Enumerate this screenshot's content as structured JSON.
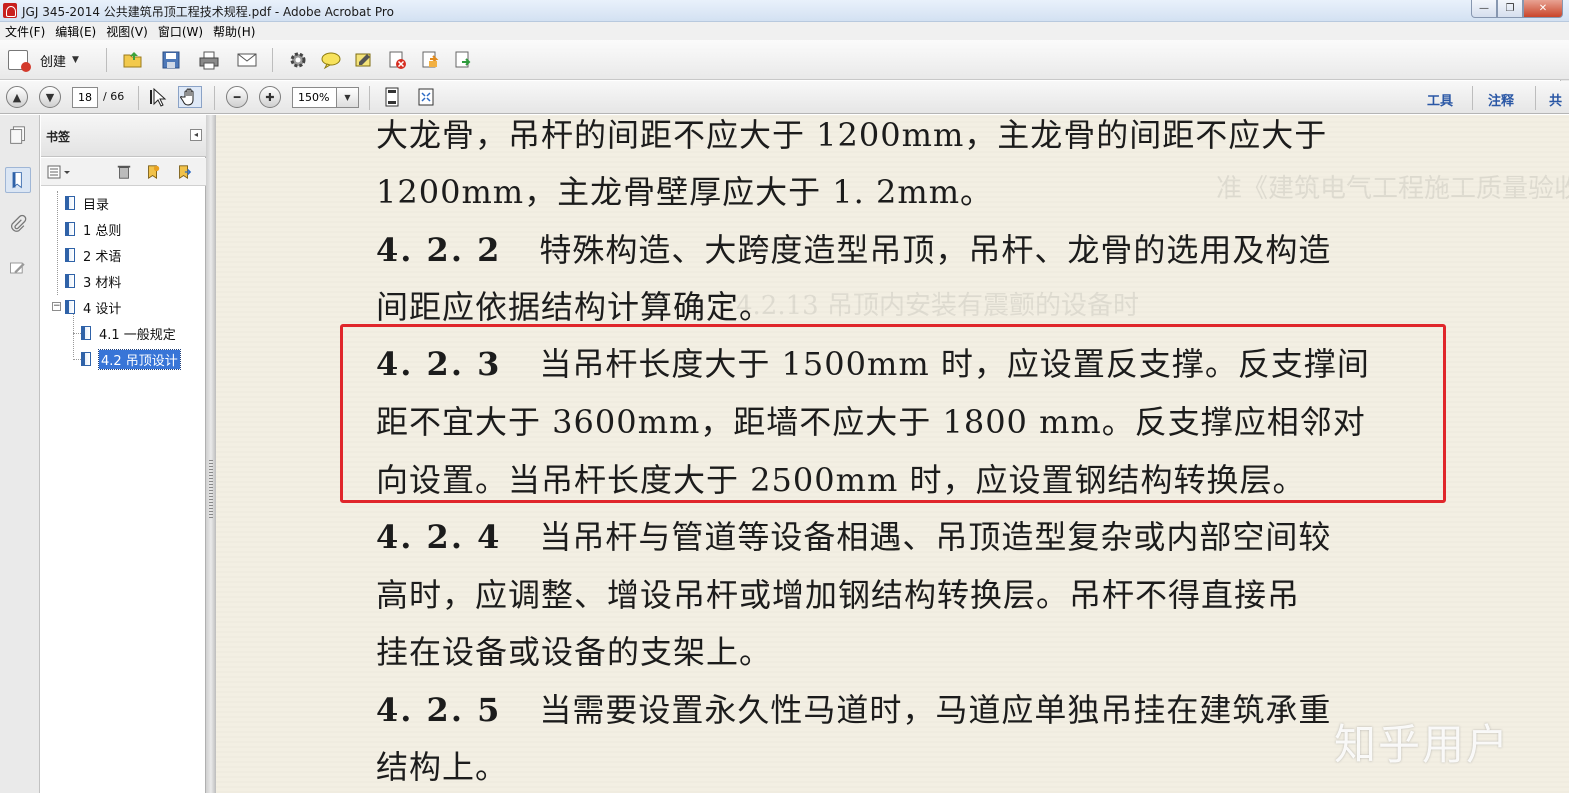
{
  "window": {
    "title": "JGJ 345-2014 公共建筑吊顶工程技术规程.pdf - Adobe Acrobat Pro",
    "controls": {
      "minimize": "—",
      "restore": "❐",
      "close": "✕"
    }
  },
  "menu": [
    "文件(F)",
    "编辑(E)",
    "视图(V)",
    "窗口(W)",
    "帮助(H)"
  ],
  "toolbar": {
    "create_label": "创建",
    "icons": [
      "open-folder-icon",
      "save-icon",
      "print-icon",
      "email-icon",
      "settings-gear-icon",
      "comment-bubble-icon",
      "sign-icon",
      "delete-page-icon",
      "export-icon",
      "share-icon"
    ]
  },
  "nav": {
    "page_current": "18",
    "page_total": "/ 66",
    "zoom": "150%",
    "tools_label": "工具",
    "comment_label": "注释",
    "share_label": "共"
  },
  "bookmarks": {
    "title": "书签",
    "items": [
      {
        "label": "目录",
        "level": 0
      },
      {
        "label": "1 总则",
        "level": 0
      },
      {
        "label": "2 术语",
        "level": 0
      },
      {
        "label": "3 材料",
        "level": 0
      },
      {
        "label": "4 设计",
        "level": 0,
        "expanded": true
      },
      {
        "label": "4.1 一般规定",
        "level": 1
      },
      {
        "label": "4.2 吊顶设计",
        "level": 1,
        "selected": true
      }
    ]
  },
  "document": {
    "lines": [
      {
        "text": "大龙骨，吊杆的间距不应大于 1200mm，主龙骨的间距不应大于"
      },
      {
        "text": "1200mm，主龙骨壁厚应大于 1. 2mm。"
      },
      {
        "section": "4. 2. 2",
        "text": "特殊构造、大跨度造型吊顶，吊杆、龙骨的选用及构造"
      },
      {
        "text": "间距应依据结构计算确定。"
      },
      {
        "section": "4. 2. 3",
        "text": "当吊杆长度大于 1500mm 时，应设置反支撑。反支撑间"
      },
      {
        "text": "距不宜大于 3600mm，距墙不应大于 1800 mm。反支撑应相邻对"
      },
      {
        "text": "向设置。当吊杆长度大于 2500mm 时，应设置钢结构转换层。"
      },
      {
        "section": "4. 2. 4",
        "text": "当吊杆与管道等设备相遇、吊顶造型复杂或内部空间较"
      },
      {
        "text": "高时，应调整、增设吊杆或增加钢结构转换层。吊杆不得直接吊"
      },
      {
        "text": "挂在设备或设备的支架上。"
      },
      {
        "section": "4. 2. 5",
        "text": "当需要设置永久性马道时，马道应单独吊挂在建筑承重"
      },
      {
        "text": "结构上。"
      }
    ],
    "watermark": "知乎用户",
    "highlight_color": "#e0262b"
  }
}
